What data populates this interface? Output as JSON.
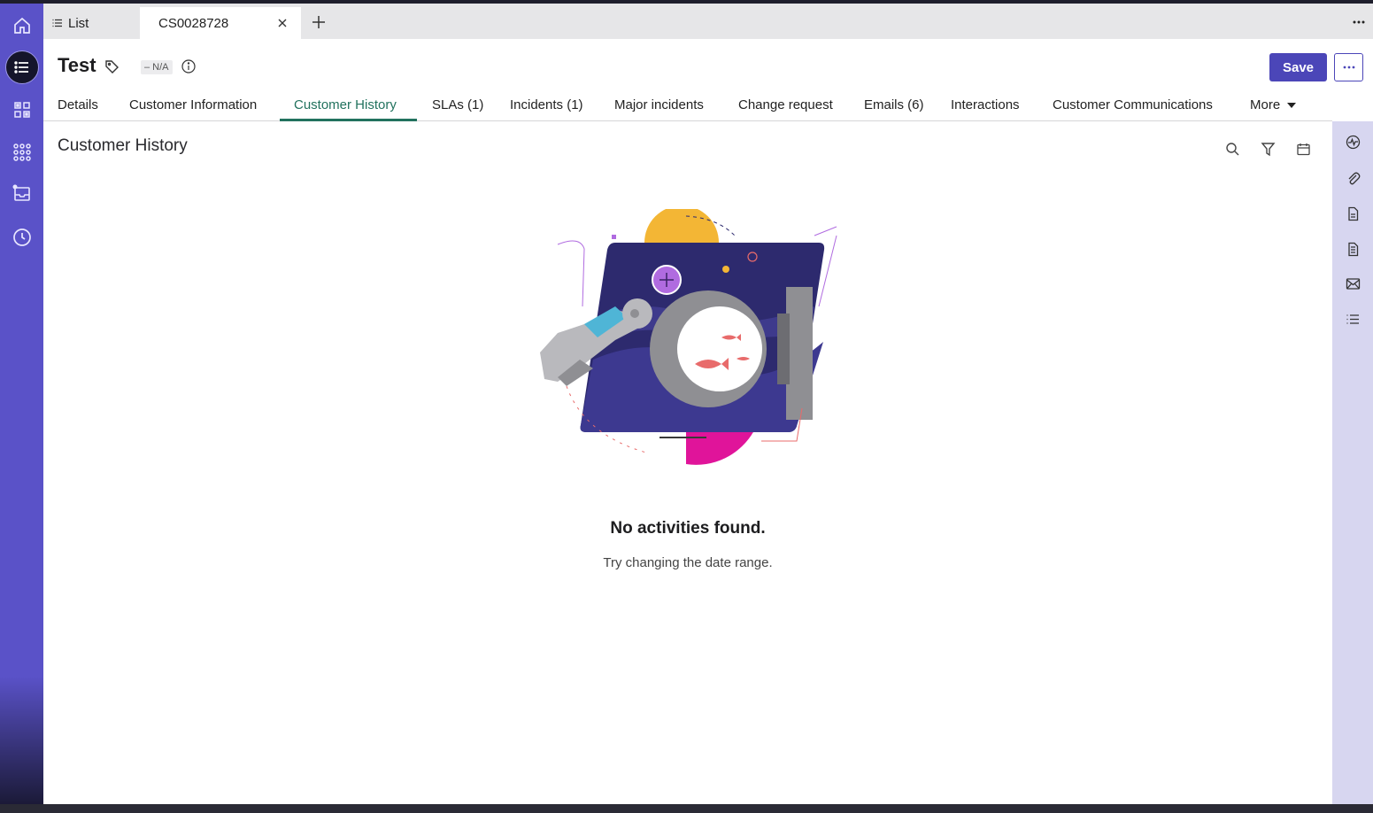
{
  "tabs": {
    "list_label": "List",
    "active_label": "CS0028728"
  },
  "record": {
    "title": "Test",
    "badge": "– N/A",
    "save_label": "Save"
  },
  "nav": {
    "items": [
      {
        "label": "Details"
      },
      {
        "label": "Customer Information"
      },
      {
        "label": "Customer History"
      },
      {
        "label": "SLAs (1)"
      },
      {
        "label": "Incidents (1)"
      },
      {
        "label": "Major incidents"
      },
      {
        "label": "Change request"
      },
      {
        "label": "Emails (6)"
      },
      {
        "label": "Interactions"
      },
      {
        "label": "Customer Communications"
      },
      {
        "label": "More"
      }
    ],
    "active_index": 2
  },
  "section": {
    "title": "Customer History"
  },
  "empty_state": {
    "title": "No activities found.",
    "subtitle": "Try changing the date range."
  },
  "icons": {
    "left_rail": [
      "home-icon",
      "list-icon",
      "workspace-icon",
      "apps-icon",
      "inbox-icon",
      "history-icon"
    ],
    "toolbar": [
      "search-icon",
      "filter-icon",
      "calendar-icon"
    ],
    "right_rail": [
      "activity-icon",
      "attachment-icon",
      "document-icon",
      "record-icon",
      "email-icon",
      "list-icon"
    ]
  },
  "colors": {
    "brand": "#4b46b8",
    "rail": "#5a52c8",
    "active_tab": "#22725e",
    "right_rail": "#d7d6f0"
  }
}
